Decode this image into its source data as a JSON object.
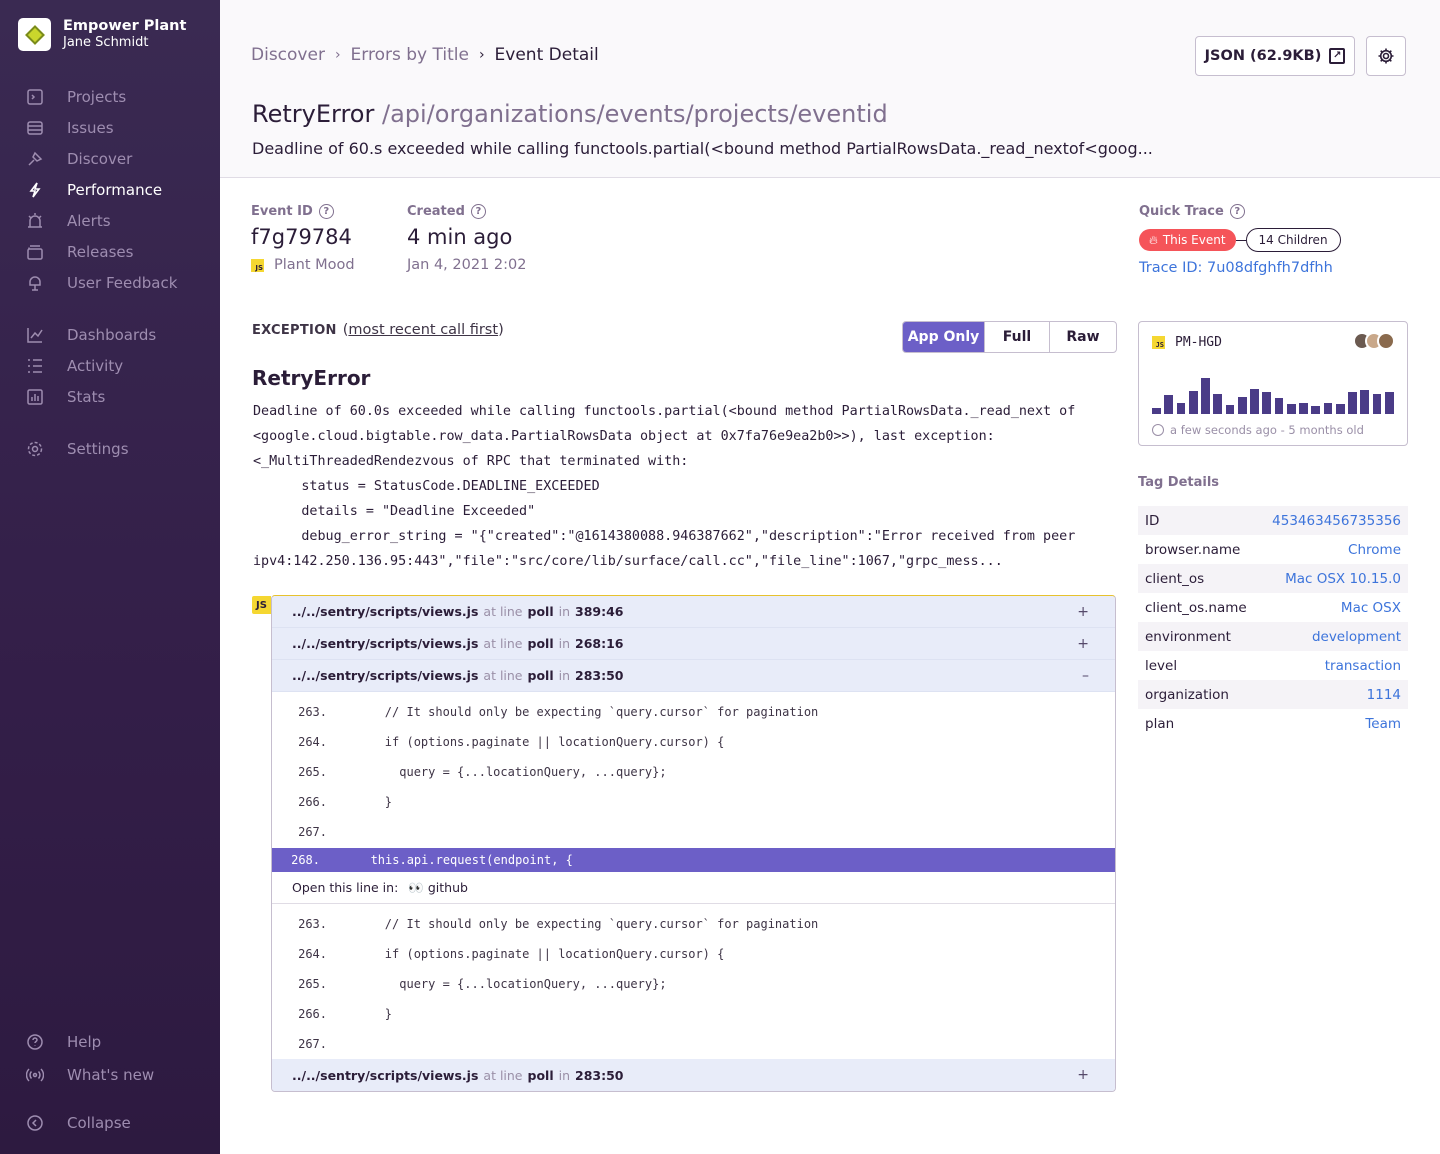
{
  "org": {
    "name": "Empower Plant",
    "user": "Jane Schmidt"
  },
  "nav": {
    "primary": [
      {
        "label": "Projects",
        "icon": "projects-icon"
      },
      {
        "label": "Issues",
        "icon": "issues-icon"
      },
      {
        "label": "Discover",
        "icon": "discover-icon"
      },
      {
        "label": "Performance",
        "icon": "performance-icon",
        "active": true
      },
      {
        "label": "Alerts",
        "icon": "alerts-icon"
      },
      {
        "label": "Releases",
        "icon": "releases-icon"
      },
      {
        "label": "User Feedback",
        "icon": "user-feedback-icon"
      }
    ],
    "secondary": [
      {
        "label": "Dashboards",
        "icon": "dashboards-icon"
      },
      {
        "label": "Activity",
        "icon": "activity-icon"
      },
      {
        "label": "Stats",
        "icon": "stats-icon"
      }
    ],
    "settings": "Settings",
    "help": "Help",
    "whats_new": "What's new",
    "collapse": "Collapse"
  },
  "breadcrumb": {
    "b1": "Discover",
    "b2": "Errors by Title",
    "b3": "Event Detail"
  },
  "header": {
    "json_button": "JSON (62.9KB)",
    "title_type": "RetryError",
    "title_path": "/api/organizations/events/projects/eventid",
    "subtitle": "Deadline of 60.s exceeded while calling functools.partial(<bound method PartialRowsData._read_nextof<goog..."
  },
  "meta": {
    "event_id_label": "Event ID",
    "event_id": "f7g79784",
    "project": "Plant Mood",
    "created_label": "Created",
    "created": "4 min ago",
    "created_date": "Jan 4, 2021 2:02"
  },
  "quick_trace": {
    "label": "Quick Trace",
    "this_event": "This Event",
    "children": "14 Children",
    "trace_id": "Trace ID: 7u08dfghfh7dfhh"
  },
  "exception": {
    "label": "EXCEPTION",
    "order_open": "(",
    "order": "most recent call first",
    "order_close": ")",
    "toggles": [
      "App Only",
      "Full",
      "Raw"
    ],
    "type": "RetryError",
    "message": "Deadline of 60.0s exceeded while calling functools.partial(<bound method PartialRowsData._read_next of\n<google.cloud.bigtable.row_data.PartialRowsData object at 0x7fa76e9ea2b0>>), last exception:\n<_MultiThreadedRendezvous of RPC that terminated with:\n      status = StatusCode.DEADLINE_EXCEEDED\n      details = \"Deadline Exceeded\"\n      debug_error_string = \"{\"created\":\"@1614380088.946387662\",\"description\":\"Error received from peer\nipv4:142.250.136.95:443\",\"file\":\"src/core/lib/surface/call.cc\",\"file_line\":1067,\"grpc_mess..."
  },
  "frames": [
    {
      "file": "../../sentry/scripts/views.js",
      "at": "at line",
      "fn": "poll",
      "in": "in",
      "loc": "389:46",
      "toggle": "+"
    },
    {
      "file": "../../sentry/scripts/views.js",
      "at": "at line",
      "fn": "poll",
      "in": "in",
      "loc": "268:16",
      "toggle": "+"
    },
    {
      "file": "../../sentry/scripts/views.js",
      "at": "at line",
      "fn": "poll",
      "in": "in",
      "loc": "283:50",
      "toggle": "–"
    },
    {
      "file": "../../sentry/scripts/views.js",
      "at": "at line",
      "fn": "poll",
      "in": "in",
      "loc": "283:50",
      "toggle": "+"
    }
  ],
  "code_before": [
    {
      "n": "263.",
      "t": "        // It should only be expecting `query.cursor` for pagination"
    },
    {
      "n": "264.",
      "t": "        if (options.paginate || locationQuery.cursor) {"
    },
    {
      "n": "265.",
      "t": "          query = {...locationQuery, ...query};"
    },
    {
      "n": "266.",
      "t": "        }"
    },
    {
      "n": "267.",
      "t": ""
    }
  ],
  "code_highlight": {
    "n": "268.",
    "t": "       this.api.request(endpoint, {"
  },
  "open_line": {
    "label": "Open this line in:",
    "emoji": "👀",
    "target": "github"
  },
  "code_after": [
    {
      "n": "263.",
      "t": "        // It should only be expecting `query.cursor` for pagination"
    },
    {
      "n": "264.",
      "t": "        if (options.paginate || locationQuery.cursor) {"
    },
    {
      "n": "265.",
      "t": "          query = {...locationQuery, ...query};"
    },
    {
      "n": "266.",
      "t": "        }"
    },
    {
      "n": "267.",
      "t": ""
    }
  ],
  "issue_card": {
    "short_id": "PM-HGD",
    "footer": "a few seconds ago - 5 months old",
    "bar_values": [
      0.18,
      0.52,
      0.3,
      0.65,
      1.0,
      0.55,
      0.25,
      0.48,
      0.7,
      0.62,
      0.45,
      0.28,
      0.3,
      0.22,
      0.3,
      0.27,
      0.6,
      0.68,
      0.55,
      0.6
    ]
  },
  "tags": {
    "title": "Tag Details",
    "rows": [
      {
        "k": "ID",
        "v": "453463456735356"
      },
      {
        "k": "browser.name",
        "v": "Chrome"
      },
      {
        "k": "client_os",
        "v": "Mac OSX 10.15.0"
      },
      {
        "k": "client_os.name",
        "v": "Mac OSX"
      },
      {
        "k": "environment",
        "v": "development"
      },
      {
        "k": "level",
        "v": "transaction"
      },
      {
        "k": "organization",
        "v": "1114"
      },
      {
        "k": "plan",
        "v": "Team"
      }
    ]
  },
  "colors": {
    "sidebar": "#352349",
    "accent": "#6c5fc7",
    "link": "#3d74db",
    "danger": "#f55459"
  }
}
